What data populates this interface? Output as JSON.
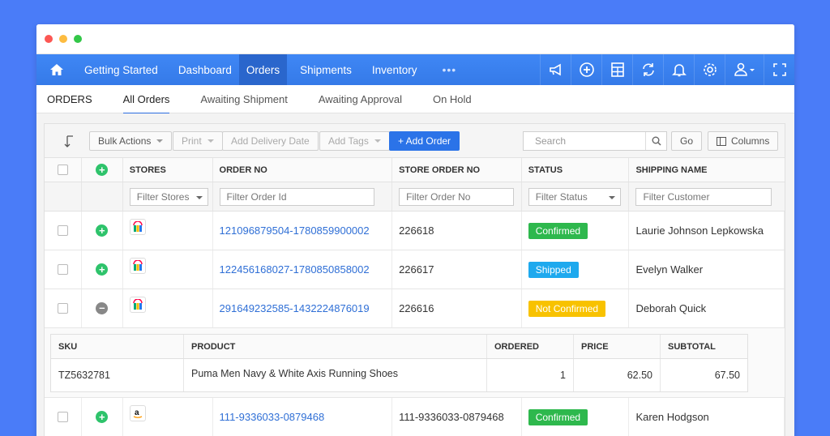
{
  "nav": {
    "items": [
      "Getting Started",
      "Dashboard",
      "Orders",
      "Shipments",
      "Inventory"
    ],
    "more": "•••"
  },
  "subtabs": {
    "title": "ORDERS",
    "items": [
      "All Orders",
      "Awaiting Shipment",
      "Awaiting Approval",
      "On Hold"
    ]
  },
  "toolbar": {
    "bulk_actions": "Bulk Actions",
    "print": "Print",
    "add_delivery_date": "Add Delivery Date",
    "add_tags": "Add Tags",
    "add_order": "+ Add Order",
    "search_placeholder": "Search",
    "go": "Go",
    "columns": "Columns"
  },
  "table": {
    "headers": [
      "STORES",
      "ORDER NO",
      "STORE ORDER NO",
      "STATUS",
      "SHIPPING NAME"
    ],
    "filters": [
      "Filter Stores",
      "Filter Order Id",
      "Filter Order No",
      "Filter Status",
      "Filter Customer"
    ],
    "rows": [
      {
        "order_no": "121096879504-1780859900002",
        "store_order_no": "226618",
        "status": "Confirmed",
        "shipping_name": "Laurie Johnson Lepkowska"
      },
      {
        "order_no": "122456168027-1780850858002",
        "store_order_no": "226617",
        "status": "Shipped",
        "shipping_name": "Evelyn Walker"
      },
      {
        "order_no": "291649232585-1432224876019",
        "store_order_no": "226616",
        "status": "Not Confirmed",
        "shipping_name": "Deborah Quick"
      },
      {
        "order_no": "111-9336033-0879468",
        "store_order_no": "111-9336033-0879468",
        "status": "Confirmed",
        "shipping_name": "Karen Hodgson"
      }
    ]
  },
  "details": {
    "headers": [
      "SKU",
      "PRODUCT",
      "ORDERED",
      "PRICE",
      "SUBTOTAL"
    ],
    "row": {
      "sku": "TZ5632781",
      "product": "Puma Men Navy & White Axis Running Shoes",
      "ordered": "1",
      "price": "62.50",
      "subtotal": "67.50"
    }
  },
  "colors": {
    "background": "#4a7cf8",
    "navbar": "#3b82f0",
    "confirmed": "#2eb84d",
    "shipped": "#1ea9ee",
    "not_confirmed": "#f8c200"
  }
}
